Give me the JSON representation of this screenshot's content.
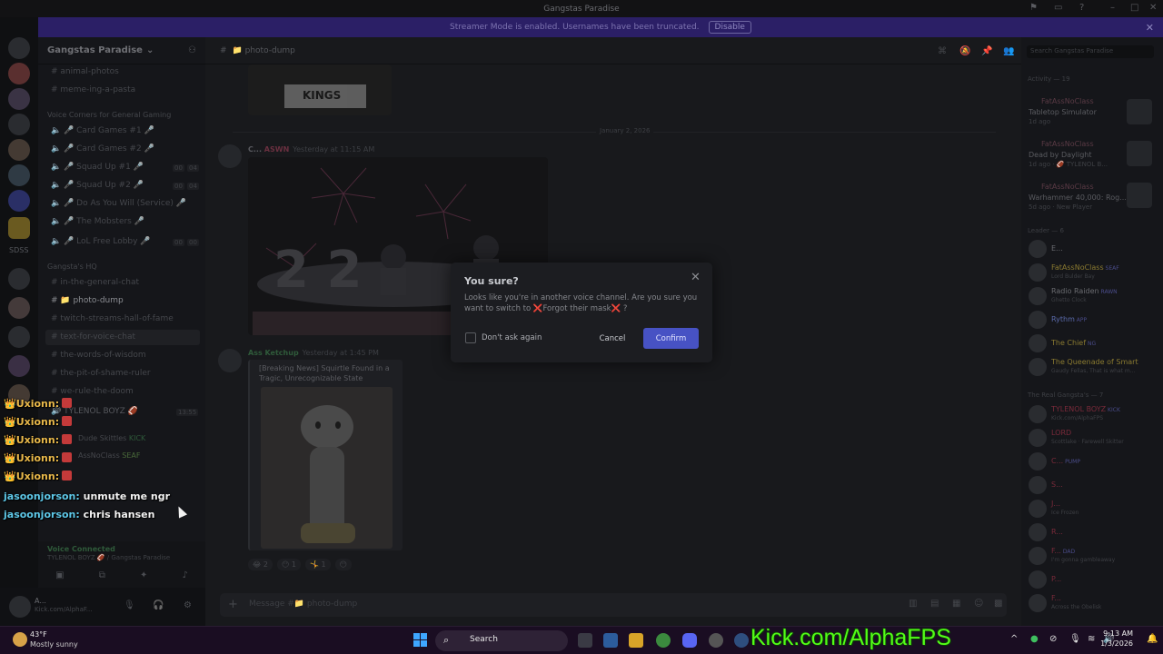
{
  "window": {
    "title": "Gangstas Paradise"
  },
  "streamer_bar": {
    "text": "Streamer Mode is enabled. Usernames have been truncated.",
    "disable_label": "Disable"
  },
  "server": {
    "name": "Gangstas Paradise"
  },
  "channels": {
    "top": [
      "animal-photos",
      "meme-ing-a-pasta"
    ],
    "voice_category": "Voice Corners for General Gaming",
    "voice": [
      "🎤 Card Games #1 🎤",
      "🎤 Card Games #2 🎤",
      "🎤 Squad Up #1 🎤",
      "🎤 Squad Up #2 🎤",
      "🎤 Do As You Will (Service) 🎤",
      "🎤 The Mobsters 🎤",
      "🎤 LoL Free Lobby 🎤"
    ],
    "counts": [
      "00",
      "04",
      "00",
      "04",
      "00",
      "00"
    ],
    "hq_category": "Gangsta's HQ",
    "hq": [
      "in-the-general-chat",
      "📁 photo-dump",
      "twitch-streams-hall-of-fame",
      "text-for-voice-chat",
      "the-words-of-wisdom",
      "the-pit-of-shame-ruler",
      "we-rule-the-doom"
    ],
    "voice_channel": "TYLENOL BOYZ 🏈",
    "voice_count": "13:55",
    "voice_users": [
      "Dude Skittles",
      "AssNoClass"
    ],
    "voice_users_badges": [
      "KICK",
      "SEAF"
    ]
  },
  "chat_overlay": [
    {
      "user": "👑Uxionn:",
      "msg": ""
    },
    {
      "user": "👑Uxionn:",
      "msg": ""
    },
    {
      "user": "👑Uxionn:",
      "msg": ""
    },
    {
      "user": "👑Uxionn:",
      "msg": ""
    },
    {
      "user": "👑Uxionn:",
      "msg": ""
    },
    {
      "user": "jasoonjorson:",
      "msg": "unmute me ngr"
    },
    {
      "user": "jasoonjorson:",
      "msg": "chris hansen"
    }
  ],
  "voice_connected": {
    "status": "Voice Connected",
    "channel": "TYLENOL BOYZ 🏈 / Gangstas Paradise"
  },
  "user_panel": {
    "name": "A...",
    "status": "Kick.com/AlphaF..."
  },
  "main": {
    "channel": "📁 photo-dump",
    "date_divider": "January 2, 2026",
    "msg1": {
      "author": "C...",
      "role": "ASWN",
      "time": "Yesterday at 11:15 AM"
    },
    "msg2": {
      "author": "Ass Ketchup",
      "time": "Yesterday at 1:45 PM"
    },
    "embed_title": "[Breaking News] Squirtle Found in a Tragic, Unrecognizable State",
    "reactions": [
      "😂 2",
      "😶 1",
      "🤸 1",
      "😶"
    ],
    "composer_placeholder": "Message #📁 photo-dump",
    "first_img_text": "KINGS",
    "image2_text": "2 2"
  },
  "rightbar": {
    "search": "Search Gangstas Paradise",
    "activity_header": "Activity — 19",
    "activity": [
      {
        "name": "FatAssNoClass",
        "game": "Tabletop Simulator",
        "sub": "1d ago"
      },
      {
        "name": "FatAssNoClass",
        "game": "Dead by Daylight",
        "sub": "1d ago · 🏈 TYLENOL B..."
      },
      {
        "name": "FatAssNoClass",
        "game": "Warhammer 40,000: Rog...",
        "sub": "5d ago · New Player"
      }
    ],
    "leader_header": "Leader — 6",
    "leaders": [
      {
        "name": "E...",
        "sub": "",
        "color": "#6a6b70"
      },
      {
        "name": "FatAssNoClass",
        "sub": "Lord Bulder Bay",
        "color": "#8a7a30",
        "tag": "SEAF"
      },
      {
        "name": "Radio Raiden",
        "sub": "Ghetto Clock",
        "color": "#6a6b70",
        "tag": "RAWN"
      },
      {
        "name": "Rythm",
        "sub": "",
        "color": "#5a6aaa",
        "tag": "APP"
      },
      {
        "name": "The Chief",
        "sub": "",
        "color": "#8a7a30",
        "tag": "NG"
      },
      {
        "name": "The Queenade of Smart",
        "sub": "Gaudy Fellas, That is what m...",
        "color": "#8a7a30"
      }
    ],
    "gang_header": "The Real Gangsta's — 7",
    "gang": [
      {
        "name": "TYLENOL BOYZ",
        "sub": "Kick.com/AlphaFPS",
        "color": "#7a2a3a",
        "tag": "KICK"
      },
      {
        "name": "LORD",
        "sub": "Scottlake · Farewell Skitter",
        "color": "#7a2a3a"
      },
      {
        "name": "C...",
        "sub": "",
        "color": "#7a2a3a",
        "tag": "PUMP"
      },
      {
        "name": "S...",
        "sub": "",
        "color": "#7a2a3a"
      },
      {
        "name": "J...",
        "sub": "Ice Frozen",
        "color": "#7a2a3a"
      },
      {
        "name": "R...",
        "sub": "",
        "color": "#7a2a3a"
      },
      {
        "name": "F...",
        "sub": "I'm gonna gambleaway",
        "color": "#7a2a3a",
        "tag": "DAD"
      },
      {
        "name": "P...",
        "sub": "",
        "color": "#7a2a3a"
      },
      {
        "name": "F...",
        "sub": "Across the Obelisk",
        "color": "#7a2a3a"
      }
    ]
  },
  "modal": {
    "title": "You sure?",
    "body": "Looks like you're in another voice channel. Are you sure you want to switch to ❌Forgot their mask❌ ?",
    "checkbox_label": "Don't ask again",
    "cancel_label": "Cancel",
    "confirm_label": "Confirm",
    "accent": "#4752c4"
  },
  "taskbar": {
    "temp": "43°F",
    "weather": "Mostly sunny",
    "search": "Search",
    "kick": "Kick.com/AlphaFPS",
    "time": "9:13 AM",
    "date": "1/3/2026"
  }
}
